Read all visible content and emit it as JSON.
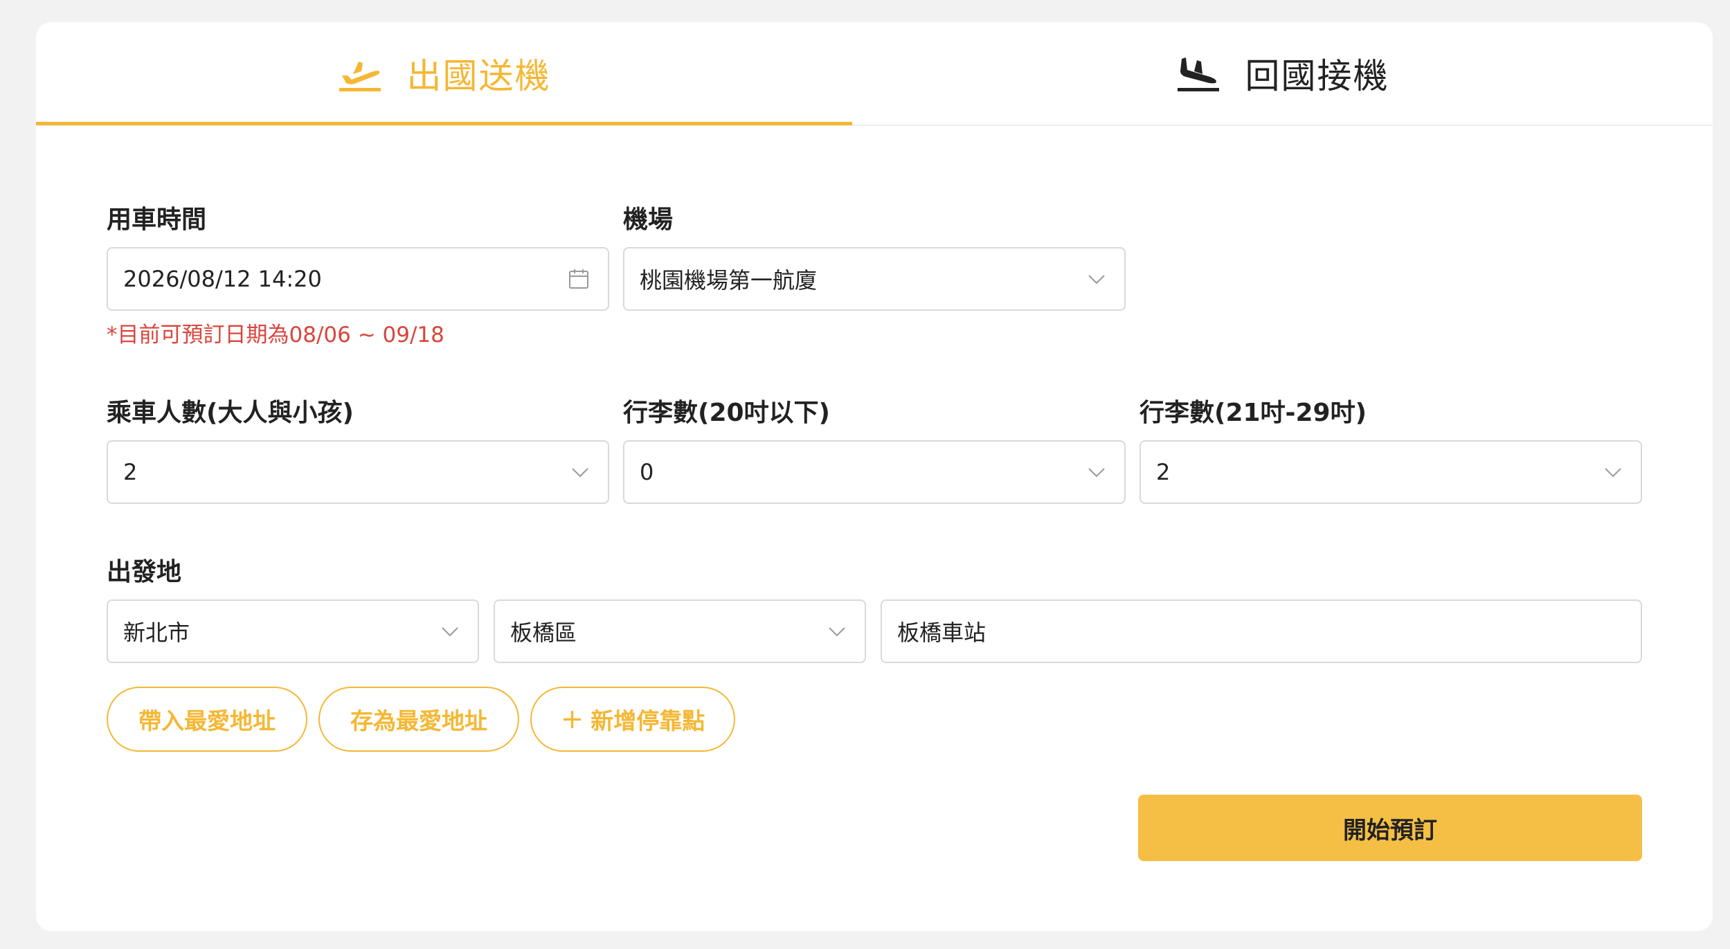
{
  "tabs": [
    {
      "label": "出國送機",
      "icon": "plane-takeoff-icon",
      "active": true
    },
    {
      "label": "回國接機",
      "icon": "plane-landing-icon",
      "active": false
    }
  ],
  "form": {
    "pickup_time": {
      "label": "用車時間",
      "value": "2026/08/12 14:20",
      "icon": "calendar-icon",
      "note": "*目前可預訂日期為08/06 ~ 09/18"
    },
    "airport": {
      "label": "機場",
      "value": "桃園機場第一航廈"
    },
    "passengers": {
      "label": "乘車人數(大人與小孩)",
      "value": "2"
    },
    "luggage_small": {
      "label": "行李數(20吋以下)",
      "value": "0"
    },
    "luggage_large": {
      "label": "行李數(21吋-29吋)",
      "value": "2"
    },
    "origin": {
      "label": "出發地",
      "city": "新北市",
      "district": "板橋區",
      "address": "板橋車站"
    }
  },
  "actions": {
    "load_favorite": "帶入最愛地址",
    "save_favorite": "存為最愛地址",
    "add_stop_plus": "+",
    "add_stop": "新增停靠點",
    "submit": "開始預訂"
  },
  "colors": {
    "accent": "#f5b733",
    "button": "#f5bf45",
    "note": "#d9453c"
  }
}
